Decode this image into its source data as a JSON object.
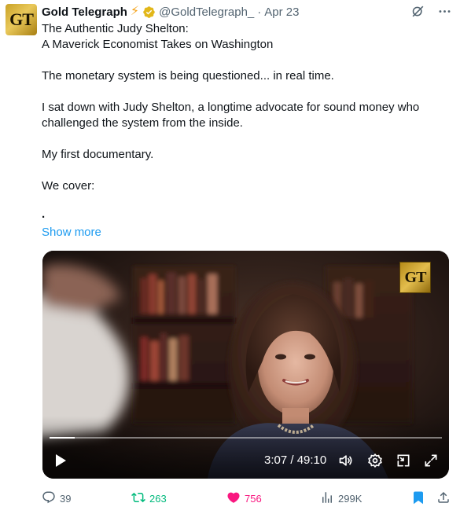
{
  "author": {
    "display_name": "Gold Telegraph",
    "handle": "@GoldTelegraph_",
    "separator": "·",
    "date": "Apr 23",
    "avatar_text": "GT",
    "badge_emoji": "⚡",
    "verified_color": "#e2b719"
  },
  "body": {
    "title_line1": "The Authentic Judy Shelton:",
    "title_line2": "A Maverick Economist Takes on Washington",
    "para1": "The monetary system is being questioned... in real time.",
    "para2": "I sat down with Judy Shelton, a longtime advocate for sound money who challenged the system from the inside.",
    "para3": "My first documentary.",
    "para4": "We cover:",
    "bullet": "·",
    "show_more": "Show more"
  },
  "video": {
    "watermark_text": "GT",
    "time_readout": "3:07 / 49:10",
    "progress": 0.0635
  },
  "actions": {
    "replies": "39",
    "reposts": "263",
    "likes": "756",
    "views": "299K"
  },
  "colors": {
    "accent": "#1d9bf0",
    "repost": "#00ba7c",
    "like": "#f91880",
    "muted": "#536471"
  },
  "icons": [
    "grok-icon",
    "more-icon",
    "play-icon",
    "volume-icon",
    "settings-icon",
    "pip-icon",
    "fullscreen-icon",
    "reply-icon",
    "repost-icon",
    "like-icon",
    "views-icon",
    "bookmark-icon",
    "share-icon"
  ]
}
